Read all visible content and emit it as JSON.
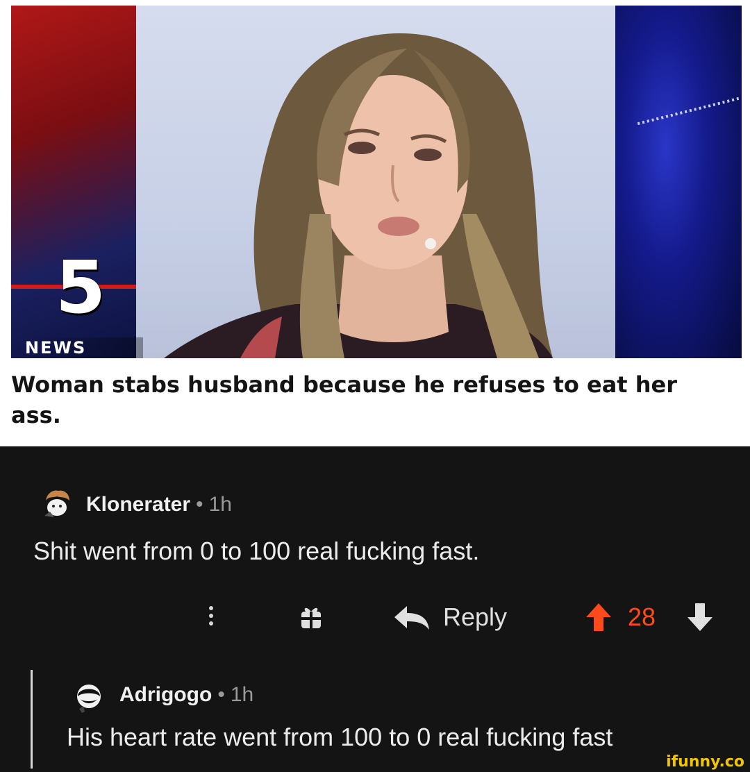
{
  "news": {
    "channel_number": "5",
    "channel_label": "NEWS",
    "headline": "Woman stabs husband because he refuses to eat her ass."
  },
  "comments": [
    {
      "username": "Klonerater",
      "separator": "•",
      "time": "1h",
      "text": "Shit went from 0 to 100 real fucking fast.",
      "actions": {
        "reply_label": "Reply",
        "score": "28"
      }
    },
    {
      "username": "Adrigogo",
      "separator": "•",
      "time": "1h",
      "text": "His heart rate went from 100 to 0 real fucking fast"
    }
  ],
  "watermark": "ifunny.co",
  "colors": {
    "background": "#141414",
    "upvote_accent": "#ff4a1c",
    "watermark": "#f4c400"
  },
  "icons": [
    "more-options-icon",
    "award-icon",
    "reply-icon",
    "upvote-arrow-icon",
    "downvote-arrow-icon"
  ]
}
